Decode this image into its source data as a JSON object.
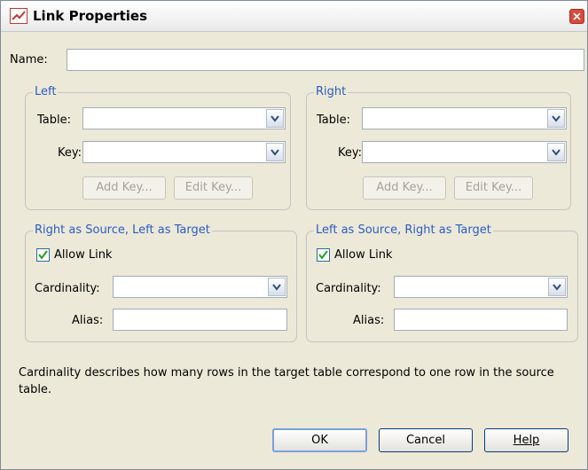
{
  "window": {
    "title": "Link Properties"
  },
  "name_field": {
    "label": "Name:",
    "value": ""
  },
  "left": {
    "legend": "Left",
    "table_label": "Table:",
    "table_value": "",
    "key_label": "Key:",
    "key_value": "",
    "add_key": "Add Key...",
    "edit_key": "Edit Key..."
  },
  "right": {
    "legend": "Right",
    "table_label": "Table:",
    "table_value": "",
    "key_label": "Key:",
    "key_value": "",
    "add_key": "Add Key...",
    "edit_key": "Edit Key..."
  },
  "rs_lt": {
    "legend": "Right as Source, Left as Target",
    "allow_link_label": "Allow Link",
    "allow_link_checked": true,
    "cardinality_label": "Cardinality:",
    "cardinality_value": "",
    "alias_label": "Alias:",
    "alias_value": ""
  },
  "ls_rt": {
    "legend": "Left as Source, Right as Target",
    "allow_link_label": "Allow Link",
    "allow_link_checked": true,
    "cardinality_label": "Cardinality:",
    "cardinality_value": "",
    "alias_label": "Alias:",
    "alias_value": ""
  },
  "description": "Cardinality describes how many rows in the target table correspond to one row in the source table.",
  "buttons": {
    "ok": "OK",
    "cancel": "Cancel",
    "help": "Help"
  }
}
